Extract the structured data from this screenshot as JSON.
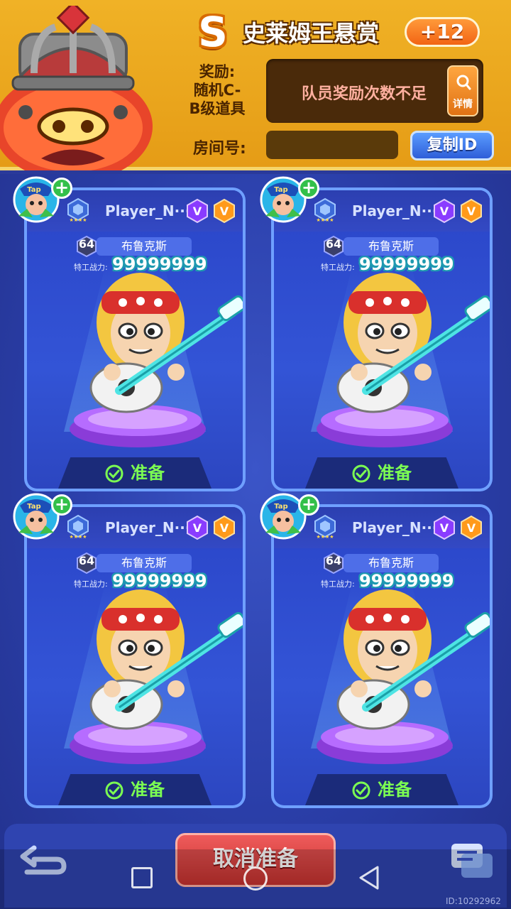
{
  "header": {
    "grade": "S",
    "title": "史莱姆王悬赏",
    "bonus": "+12",
    "reward_label": "奖励:\n随机C-\nB级道具",
    "reward_message": "队员奖励次数不足",
    "detail_label": "详情",
    "room_label": "房间号:",
    "room_value": "",
    "copy_label": "复制ID"
  },
  "players": [
    {
      "name": "Player_N···",
      "level": "64",
      "hero": "布鲁克斯",
      "power_label": "特工战力:",
      "power": "99999999",
      "status": "准备"
    },
    {
      "name": "Player_N···",
      "level": "64",
      "hero": "布鲁克斯",
      "power_label": "特工战力:",
      "power": "99999999",
      "status": "准备"
    },
    {
      "name": "Player_N···",
      "level": "64",
      "hero": "布鲁克斯",
      "power_label": "特工战力:",
      "power": "99999999",
      "status": "准备"
    },
    {
      "name": "Player_N···",
      "level": "64",
      "hero": "布鲁克斯",
      "power_label": "特工战力:",
      "power": "99999999",
      "status": "准备"
    }
  ],
  "bottom": {
    "cancel_label": "取消准备",
    "uid": "ID:10292962"
  },
  "colors": {
    "header_bg": "#f0b226",
    "ready_green": "#7cff52",
    "cancel_red": "#e04444",
    "copy_blue": "#3a72e8"
  }
}
